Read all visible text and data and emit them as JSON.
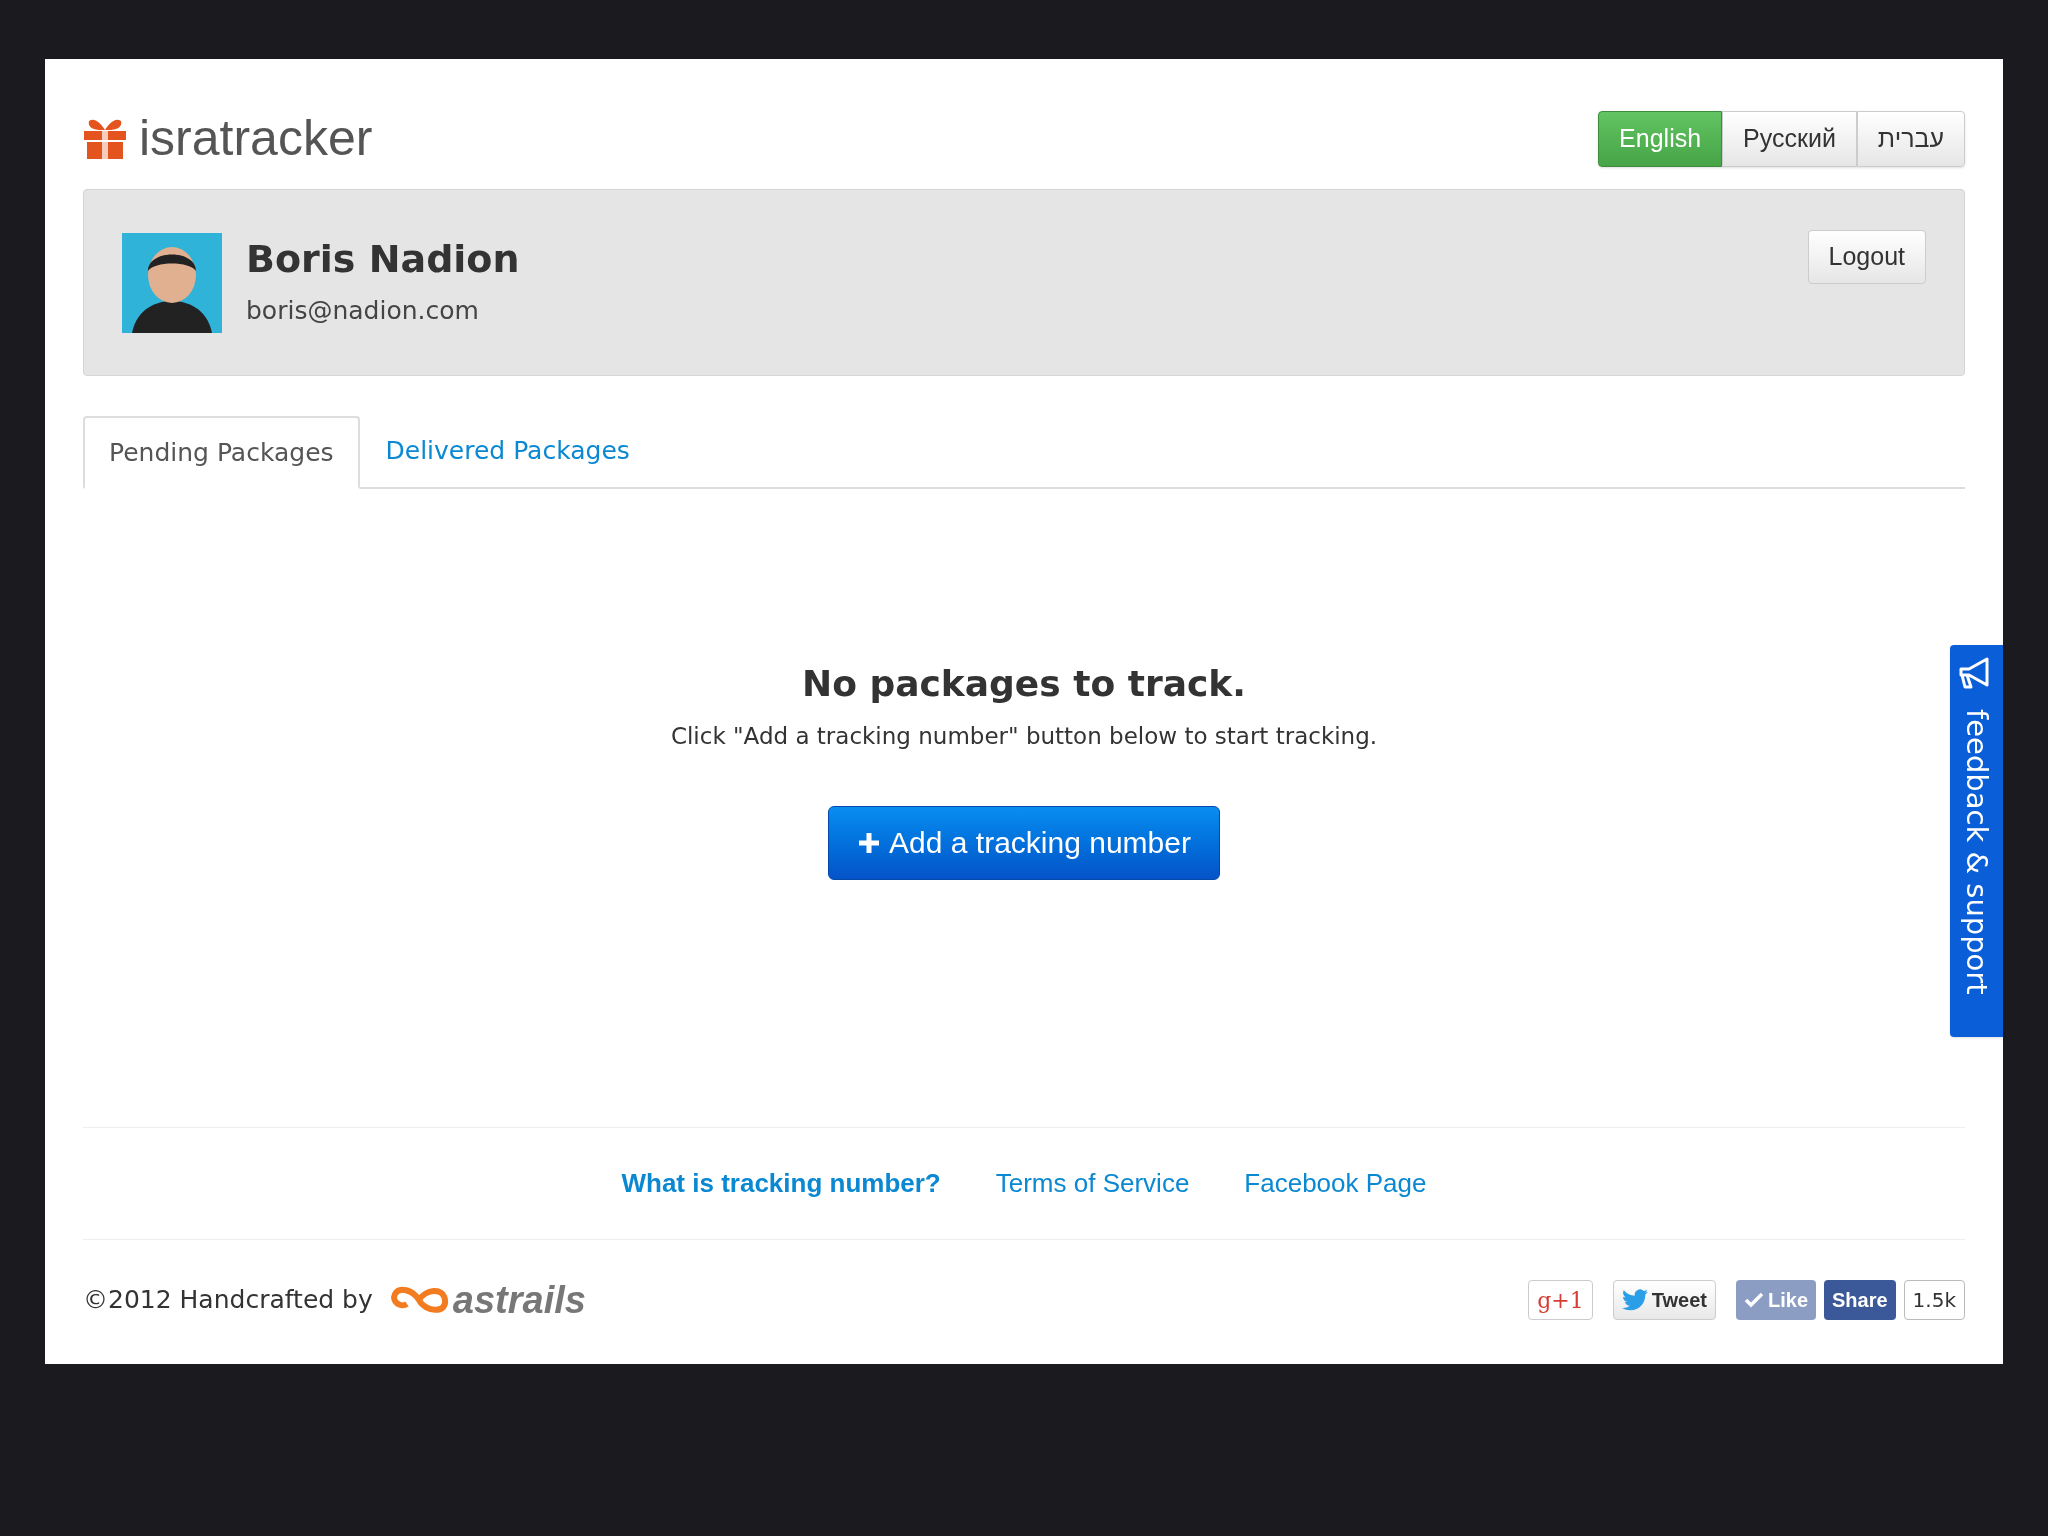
{
  "brand": "isratracker",
  "languages": [
    {
      "label": "English",
      "selected": true
    },
    {
      "label": "Русский",
      "selected": false
    },
    {
      "label": "עברית",
      "selected": false
    }
  ],
  "user": {
    "name": "Boris Nadion",
    "email": "boris@nadion.com",
    "logout": "Logout"
  },
  "tabs": [
    {
      "label": "Pending Packages",
      "selected": true
    },
    {
      "label": "Delivered Packages",
      "selected": false
    }
  ],
  "empty_state": {
    "title": "No packages to track.",
    "message": "Click \"Add a tracking number\" button below to start tracking.",
    "button": "Add a tracking number"
  },
  "footer_links": [
    {
      "label": "What is tracking number?",
      "bold": true
    },
    {
      "label": "Terms of Service",
      "bold": false
    },
    {
      "label": "Facebook Page",
      "bold": false
    }
  ],
  "credit": {
    "text": "©2012 Handcrafted by",
    "brand": "astrails"
  },
  "social": [
    {
      "kind": "gplus",
      "label": "g+1"
    },
    {
      "kind": "tweet",
      "label": "Tweet"
    },
    {
      "kind": "like",
      "label": "Like"
    },
    {
      "kind": "share",
      "label": "Share"
    },
    {
      "kind": "count",
      "label": "1.5k"
    }
  ],
  "feedback_tab": "feedback & support"
}
